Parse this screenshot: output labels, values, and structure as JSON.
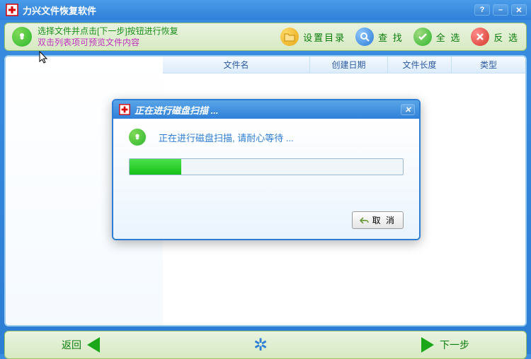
{
  "app": {
    "title": "力兴文件恢复软件"
  },
  "hints": {
    "line1": "选择文件并点击[下一步]按钮进行恢复",
    "line2": "双击列表项可预览文件内容"
  },
  "toolbar": {
    "setdir": "设置目录",
    "search": "查 找",
    "selectall": "全 选",
    "invert": "反 选"
  },
  "columns": {
    "name": "文件名",
    "date": "创建日期",
    "size": "文件长度",
    "type": "类型"
  },
  "footer": {
    "back": "返回",
    "next": "下一步"
  },
  "dialog": {
    "title": "正在进行磁盘扫描 ...",
    "message": "正在进行磁盘扫描, 请耐心等待 ...",
    "cancel": "取 消",
    "progress_percent": 19
  }
}
